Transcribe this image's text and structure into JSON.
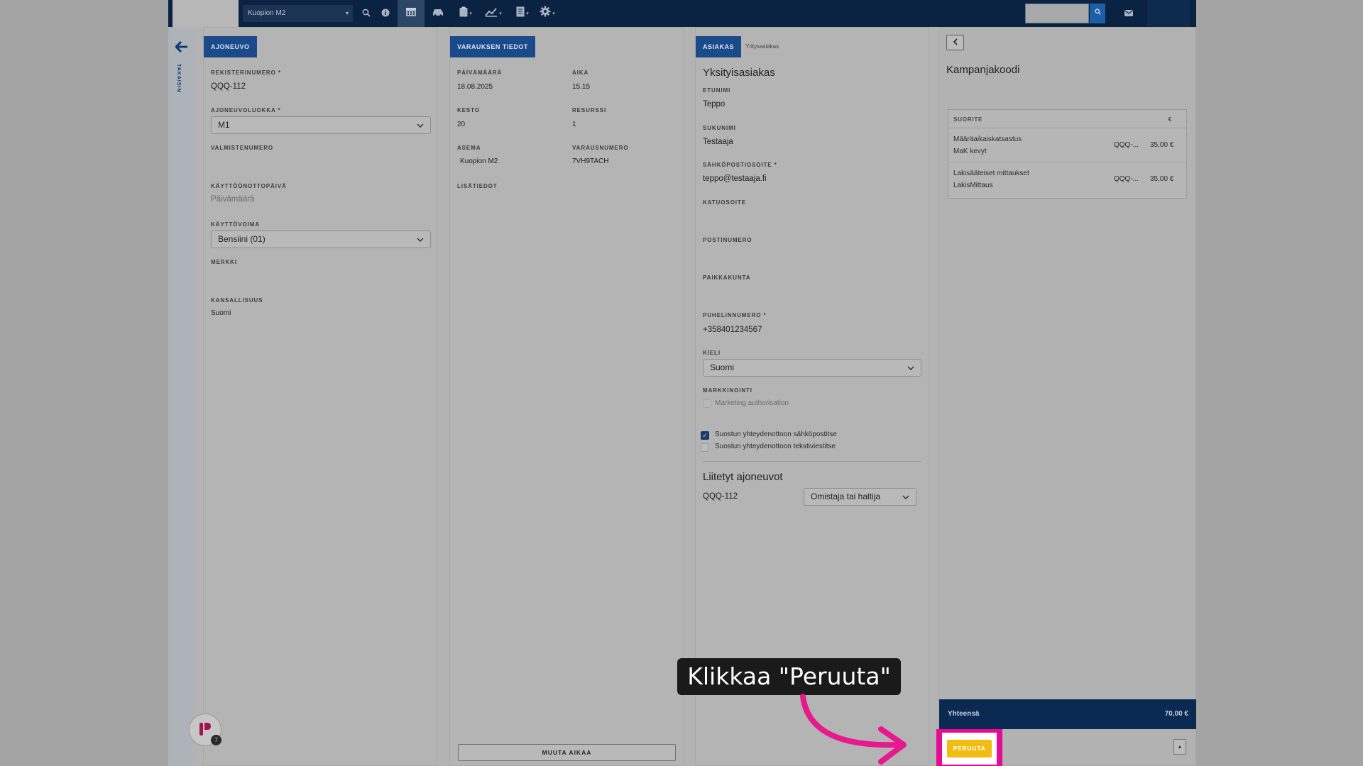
{
  "topbar": {
    "station": "Kuopion M2",
    "icons": [
      "search-icon",
      "info-icon",
      "calendar-icon",
      "car-icon",
      "clipboard-icon",
      "chart-icon",
      "document-icon",
      "gear-icon",
      "mail-icon"
    ]
  },
  "left": {
    "back_label": "TAKAISIN"
  },
  "vehicle": {
    "tab": "AJONEUVO",
    "reg_label": "REKISTERINUMERO *",
    "reg_value": "QQQ-112",
    "class_label": "AJONEUVOLUOKKA *",
    "class_value": "M1",
    "vin_label": "VALMISTENUMERO",
    "vin_value": "",
    "intro_label": "KÄYTTÖÖNOTTOPÄIVÄ",
    "intro_placeholder": "Päivämäärä",
    "fuel_label": "KÄYTTÖVOIMA",
    "fuel_value": "Bensiini (01)",
    "make_label": "MERKKI",
    "make_value": "",
    "nationality_label": "KANSALLISUUS",
    "nationality_value": "Suomi"
  },
  "booking": {
    "tab": "VARAUKSEN TIEDOT",
    "date_label": "PÄIVÄMÄÄRÄ",
    "date_value": "18.08.2025",
    "time_label": "AIKA",
    "time_value": "15.15",
    "duration_label": "KESTO",
    "duration_value": "20",
    "resource_label": "RESURSSI",
    "resource_value": "1",
    "station_label": "ASEMA",
    "station_value": "Kuopion M2",
    "booking_no_label": "VARAUSNUMERO",
    "booking_no_value": "7VH9TACH",
    "extra_label": "LISÄTIEDOT",
    "change_time_button": "MUUTA AIKAA"
  },
  "customer": {
    "tab": "ASIAKAS",
    "tab_alt": "Yritysasiakas",
    "heading": "Yksityisasiakas",
    "first_label": "ETUNIMI",
    "first_value": "Teppo",
    "last_label": "SUKUNIMI",
    "last_value": "Testaaja",
    "email_label": "SÄHKÖPOSTIOSOITE *",
    "email_value": "teppo@testaaja.fi",
    "street_label": "KATUOSOITE",
    "postal_label": "POSTINUMERO",
    "city_label": "PAIKKAKUNTA",
    "phone_label": "PUHELINNUMERO *",
    "phone_value": "+358401234567",
    "lang_label": "KIELI",
    "lang_value": "Suomi",
    "marketing_label": "MARKKINOINTI",
    "marketing_option": "Marketing authorisation",
    "consent_email": "Suostun yhteydenottoon sähköpostitse",
    "consent_sms": "Suostun yhteydenottoon tekstiviestitse",
    "linked_heading": "Liitetyt ajoneuvot",
    "linked_plate": "QQQ-112",
    "linked_role": "Omistaja tai haltija"
  },
  "summary": {
    "campaign_heading": "Kampanjakoodi",
    "col_service": "SUORITE",
    "col_currency": "€",
    "rows": [
      {
        "name": "Määräaikaiskatsastus",
        "sub": "MaK kevyt",
        "plate": "QQQ-...",
        "price": "35,00 €"
      },
      {
        "name": "Lakisääteiset mittaukset",
        "sub": "LakisMittaus",
        "plate": "QQQ-...",
        "price": "35,00 €"
      }
    ],
    "total_label": "Yhteensä",
    "total_value": "70,00 €",
    "cancel_button": "PERUUTA"
  },
  "overlay": {
    "callout": "Klikkaa \"Peruuta\"",
    "accent": "#e60a96"
  },
  "fab": {
    "badge": "7"
  }
}
